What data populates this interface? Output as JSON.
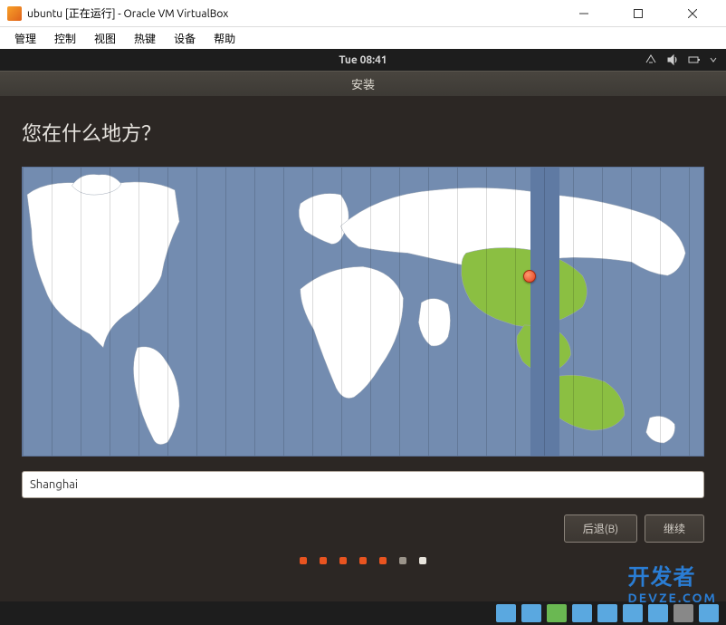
{
  "window": {
    "title": "ubuntu [正在运行] - Oracle VM VirtualBox"
  },
  "menubar": {
    "items": [
      "管理",
      "控制",
      "视图",
      "热键",
      "设备",
      "帮助"
    ]
  },
  "ubuntu_topbar": {
    "time": "Tue 08:41"
  },
  "installer": {
    "titlebar": "安装",
    "heading": "您在什么地方？",
    "location_value": "Shanghai",
    "back_button": "后退(B)",
    "continue_button": "继续"
  },
  "watermark": {
    "line1": "开发者",
    "line2": "DEVZE.COM"
  }
}
